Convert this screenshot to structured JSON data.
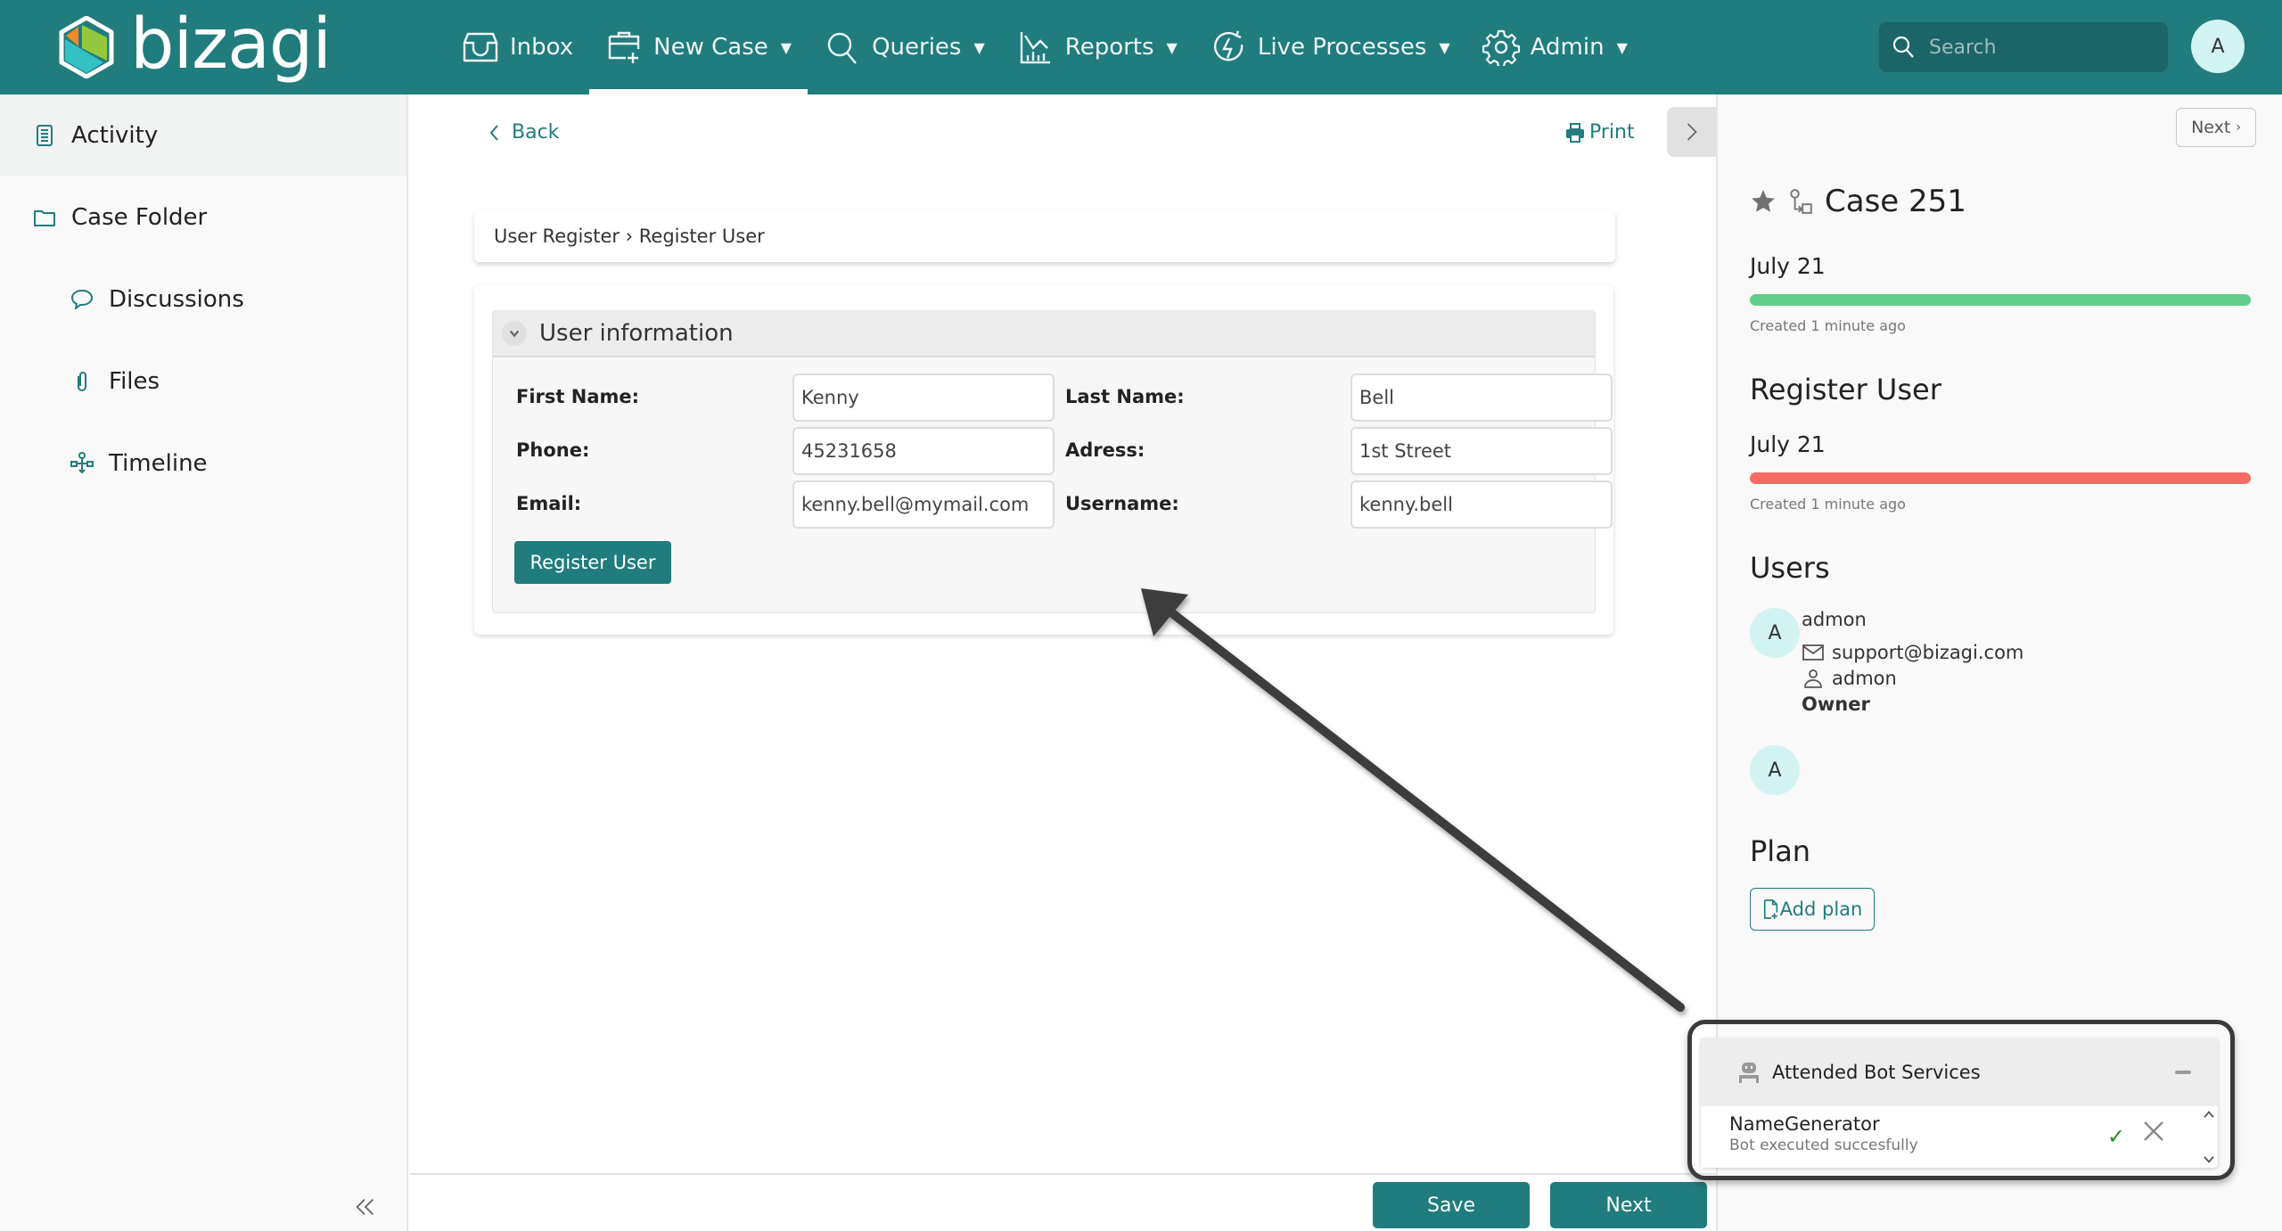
{
  "header": {
    "brand": "bizagi",
    "nav": [
      {
        "label": "Inbox",
        "icon": "inbox-icon",
        "dropdown": false,
        "active": false
      },
      {
        "label": "New Case",
        "icon": "new-case-icon",
        "dropdown": true,
        "active": true
      },
      {
        "label": "Queries",
        "icon": "search-icon",
        "dropdown": true,
        "active": false
      },
      {
        "label": "Reports",
        "icon": "reports-icon",
        "dropdown": true,
        "active": false
      },
      {
        "label": "Live Processes",
        "icon": "live-processes-icon",
        "dropdown": true,
        "active": false
      },
      {
        "label": "Admin",
        "icon": "gear-icon",
        "dropdown": true,
        "active": false
      }
    ],
    "search_placeholder": "Search",
    "avatar_initial": "A"
  },
  "sidebar": {
    "items": [
      {
        "label": "Activity",
        "icon": "activity-icon",
        "active": true
      },
      {
        "label": "Case Folder",
        "icon": "folder-icon",
        "active": false
      },
      {
        "label": "Discussions",
        "icon": "discussion-icon",
        "active": false
      },
      {
        "label": "Files",
        "icon": "paperclip-icon",
        "active": false
      },
      {
        "label": "Timeline",
        "icon": "timeline-icon",
        "active": false
      }
    ]
  },
  "main": {
    "back_label": "Back",
    "print_label": "Print",
    "breadcrumb": "User Register › Register User",
    "group_title": "User information",
    "fields": [
      {
        "label": "First Name:",
        "value": "Kenny"
      },
      {
        "label": "Last Name:",
        "value": "Bell"
      },
      {
        "label": "Phone:",
        "value": "45231658"
      },
      {
        "label": "Adress:",
        "value": "1st Street"
      },
      {
        "label": "Email:",
        "value": "kenny.bell@mymail.com"
      },
      {
        "label": "Username:",
        "value": "kenny.bell"
      }
    ],
    "register_button": "Register User",
    "save_button": "Save",
    "next_button": "Next"
  },
  "right_panel": {
    "next_label": "Next",
    "case_title": "Case 251",
    "case_date": "July 21",
    "case_created": "Created 1 minute ago",
    "case_progress": 100,
    "task_title": "Register User",
    "task_date": "July 21",
    "task_created": "Created 1 minute ago",
    "task_progress": 100,
    "users_heading": "Users",
    "users": [
      {
        "initial": "A",
        "name": "admon",
        "email": "support@bizagi.com",
        "username": "admon",
        "role": "Owner"
      },
      {
        "initial": "A"
      }
    ],
    "plan_heading": "Plan",
    "add_plan_label": "Add plan",
    "colors": {
      "case_bar": "#62cd8a",
      "task_bar": "#f46c64",
      "accent": "#217c7d"
    }
  },
  "bot_panel": {
    "title": "Attended Bot Services",
    "bot_name": "NameGenerator",
    "bot_status": "Bot executed succesfully"
  }
}
